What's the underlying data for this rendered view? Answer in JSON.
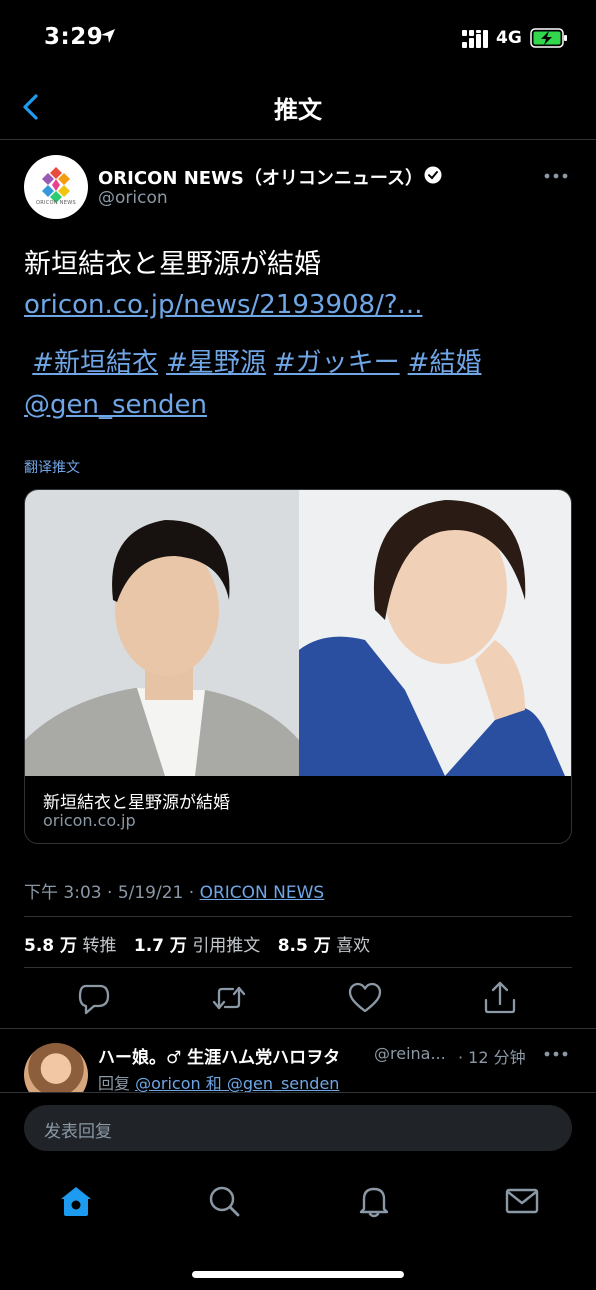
{
  "status": {
    "time": "3:29",
    "network": "4G"
  },
  "header": {
    "title": "推文"
  },
  "tweet": {
    "avatar_text": "ORICON NEWS",
    "name": "ORICON NEWS（オリコンニュース）",
    "handle": "@oricon",
    "text": "新垣結衣と星野源が結婚",
    "link": "oricon.co.jp/news/2193908/?...",
    "hashtags": [
      "#新垣結衣",
      "#星野源",
      "#ガッキー",
      "#結婚"
    ],
    "mention": "@gen_senden",
    "translate": "翻译推文",
    "card": {
      "title": "新垣結衣と星野源が結婚",
      "domain": "oricon.co.jp"
    },
    "meta": {
      "time": "下午 3:03",
      "date": "5/19/21",
      "source": "ORICON NEWS"
    },
    "stats": {
      "retweets_value": "5.8 万",
      "retweets_label": "转推",
      "quotes_value": "1.7 万",
      "quotes_label": "引用推文",
      "likes_value": "8.5 万",
      "likes_label": "喜欢"
    }
  },
  "reply": {
    "name": "ハー娘。♂ 生涯ハム党ハロヲタ",
    "handle": "@reina...",
    "time": "· 12 分钟",
    "prefix": "回复",
    "mentions": "@oricon 和 @gen_senden"
  },
  "compose": {
    "placeholder": "发表回复"
  },
  "colors": {
    "accent": "#1d9bf0",
    "link": "#6fa6e6",
    "muted": "#8b98a5",
    "divider": "#2f3336"
  }
}
